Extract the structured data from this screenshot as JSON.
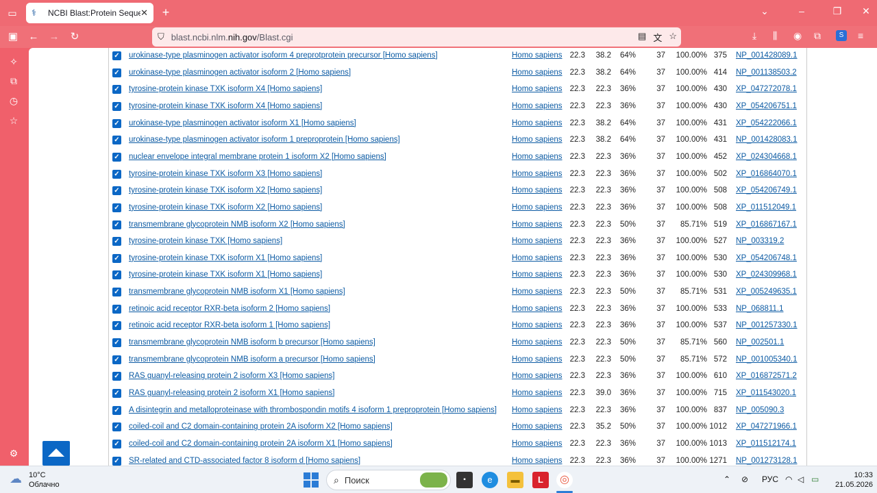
{
  "browser": {
    "tab_title": "NCBI Blast:Protein Sequence",
    "url_prefix": "blast.ncbi.nlm.",
    "url_domain": "nih.gov",
    "url_suffix": "/Blast.cgi"
  },
  "rows": [
    {
      "desc": "urokinase-type plasminogen activator isoform 4 preprotprotein precursor [Homo sapiens]",
      "sci": "Homo sapiens",
      "max": "22.3",
      "total": "38.2",
      "cover": "64%",
      "e": "37",
      "ident": "100.00%",
      "len": "375",
      "acc": "NP_001428089.1"
    },
    {
      "desc": "urokinase-type plasminogen activator isoform 2 [Homo sapiens]",
      "sci": "Homo sapiens",
      "max": "22.3",
      "total": "38.2",
      "cover": "64%",
      "e": "37",
      "ident": "100.00%",
      "len": "414",
      "acc": "NP_001138503.2"
    },
    {
      "desc": "tyrosine-protein kinase TXK isoform X4 [Homo sapiens]",
      "sci": "Homo sapiens",
      "max": "22.3",
      "total": "22.3",
      "cover": "36%",
      "e": "37",
      "ident": "100.00%",
      "len": "430",
      "acc": "XP_047272078.1"
    },
    {
      "desc": "tyrosine-protein kinase TXK isoform X4 [Homo sapiens]",
      "sci": "Homo sapiens",
      "max": "22.3",
      "total": "22.3",
      "cover": "36%",
      "e": "37",
      "ident": "100.00%",
      "len": "430",
      "acc": "XP_054206751.1"
    },
    {
      "desc": "urokinase-type plasminogen activator isoform X1 [Homo sapiens]",
      "sci": "Homo sapiens",
      "max": "22.3",
      "total": "38.2",
      "cover": "64%",
      "e": "37",
      "ident": "100.00%",
      "len": "431",
      "acc": "XP_054222066.1"
    },
    {
      "desc": "urokinase-type plasminogen activator isoform 1 preproprotein [Homo sapiens]",
      "sci": "Homo sapiens",
      "max": "22.3",
      "total": "38.2",
      "cover": "64%",
      "e": "37",
      "ident": "100.00%",
      "len": "431",
      "acc": "NP_001428083.1"
    },
    {
      "desc": "nuclear envelope integral membrane protein 1 isoform X2 [Homo sapiens]",
      "sci": "Homo sapiens",
      "max": "22.3",
      "total": "22.3",
      "cover": "36%",
      "e": "37",
      "ident": "100.00%",
      "len": "452",
      "acc": "XP_024304668.1"
    },
    {
      "desc": "tyrosine-protein kinase TXK isoform X3 [Homo sapiens]",
      "sci": "Homo sapiens",
      "max": "22.3",
      "total": "22.3",
      "cover": "36%",
      "e": "37",
      "ident": "100.00%",
      "len": "502",
      "acc": "XP_016864070.1"
    },
    {
      "desc": "tyrosine-protein kinase TXK isoform X2 [Homo sapiens]",
      "sci": "Homo sapiens",
      "max": "22.3",
      "total": "22.3",
      "cover": "36%",
      "e": "37",
      "ident": "100.00%",
      "len": "508",
      "acc": "XP_054206749.1"
    },
    {
      "desc": "tyrosine-protein kinase TXK isoform X2 [Homo sapiens]",
      "sci": "Homo sapiens",
      "max": "22.3",
      "total": "22.3",
      "cover": "36%",
      "e": "37",
      "ident": "100.00%",
      "len": "508",
      "acc": "XP_011512049.1"
    },
    {
      "desc": "transmembrane glycoprotein NMB isoform X2 [Homo sapiens]",
      "sci": "Homo sapiens",
      "max": "22.3",
      "total": "22.3",
      "cover": "50%",
      "e": "37",
      "ident": "85.71%",
      "len": "519",
      "acc": "XP_016867167.1"
    },
    {
      "desc": "tyrosine-protein kinase TXK [Homo sapiens]",
      "sci": "Homo sapiens",
      "max": "22.3",
      "total": "22.3",
      "cover": "36%",
      "e": "37",
      "ident": "100.00%",
      "len": "527",
      "acc": "NP_003319.2"
    },
    {
      "desc": "tyrosine-protein kinase TXK isoform X1 [Homo sapiens]",
      "sci": "Homo sapiens",
      "max": "22.3",
      "total": "22.3",
      "cover": "36%",
      "e": "37",
      "ident": "100.00%",
      "len": "530",
      "acc": "XP_054206748.1"
    },
    {
      "desc": "tyrosine-protein kinase TXK isoform X1 [Homo sapiens]",
      "sci": "Homo sapiens",
      "max": "22.3",
      "total": "22.3",
      "cover": "36%",
      "e": "37",
      "ident": "100.00%",
      "len": "530",
      "acc": "XP_024309968.1"
    },
    {
      "desc": "transmembrane glycoprotein NMB isoform X1 [Homo sapiens]",
      "sci": "Homo sapiens",
      "max": "22.3",
      "total": "22.3",
      "cover": "50%",
      "e": "37",
      "ident": "85.71%",
      "len": "531",
      "acc": "XP_005249635.1"
    },
    {
      "desc": "retinoic acid receptor RXR-beta isoform 2 [Homo sapiens]",
      "sci": "Homo sapiens",
      "max": "22.3",
      "total": "22.3",
      "cover": "36%",
      "e": "37",
      "ident": "100.00%",
      "len": "533",
      "acc": "NP_068811.1"
    },
    {
      "desc": "retinoic acid receptor RXR-beta isoform 1 [Homo sapiens]",
      "sci": "Homo sapiens",
      "max": "22.3",
      "total": "22.3",
      "cover": "36%",
      "e": "37",
      "ident": "100.00%",
      "len": "537",
      "acc": "NP_001257330.1"
    },
    {
      "desc": "transmembrane glycoprotein NMB isoform b precursor [Homo sapiens]",
      "sci": "Homo sapiens",
      "max": "22.3",
      "total": "22.3",
      "cover": "50%",
      "e": "37",
      "ident": "85.71%",
      "len": "560",
      "acc": "NP_002501.1"
    },
    {
      "desc": "transmembrane glycoprotein NMB isoform a precursor [Homo sapiens]",
      "sci": "Homo sapiens",
      "max": "22.3",
      "total": "22.3",
      "cover": "50%",
      "e": "37",
      "ident": "85.71%",
      "len": "572",
      "acc": "NP_001005340.1"
    },
    {
      "desc": "RAS guanyl-releasing protein 2 isoform X3 [Homo sapiens]",
      "sci": "Homo sapiens",
      "max": "22.3",
      "total": "22.3",
      "cover": "36%",
      "e": "37",
      "ident": "100.00%",
      "len": "610",
      "acc": "XP_016872571.2"
    },
    {
      "desc": "RAS guanyl-releasing protein 2 isoform X1 [Homo sapiens]",
      "sci": "Homo sapiens",
      "max": "22.3",
      "total": "39.0",
      "cover": "36%",
      "e": "37",
      "ident": "100.00%",
      "len": "715",
      "acc": "XP_011543020.1"
    },
    {
      "desc": "A disintegrin and metalloproteinase with thrombospondin motifs 4 isoform 1 preproprotein [Homo sapiens]",
      "sci": "Homo sapiens",
      "max": "22.3",
      "total": "22.3",
      "cover": "36%",
      "e": "37",
      "ident": "100.00%",
      "len": "837",
      "acc": "NP_005090.3"
    },
    {
      "desc": "coiled-coil and C2 domain-containing protein 2A isoform X2 [Homo sapiens]",
      "sci": "Homo sapiens",
      "max": "22.3",
      "total": "35.2",
      "cover": "50%",
      "e": "37",
      "ident": "100.00%",
      "len": "1012",
      "acc": "XP_047271966.1"
    },
    {
      "desc": "coiled-coil and C2 domain-containing protein 2A isoform X1 [Homo sapiens]",
      "sci": "Homo sapiens",
      "max": "22.3",
      "total": "22.3",
      "cover": "36%",
      "e": "37",
      "ident": "100.00%",
      "len": "1013",
      "acc": "XP_011512174.1"
    },
    {
      "desc": "SR-related and CTD-associated factor 8 isoform d [Homo sapiens]",
      "sci": "Homo sapiens",
      "max": "22.3",
      "total": "22.3",
      "cover": "36%",
      "e": "37",
      "ident": "100.00%",
      "len": "1271",
      "acc": "NP_001273128.1"
    }
  ],
  "taskbar": {
    "temp": "10°C",
    "weather": "Облачно",
    "search_placeholder": "Поиск",
    "lang": "РУС",
    "time": "10:33",
    "date": "21.05.2026"
  }
}
